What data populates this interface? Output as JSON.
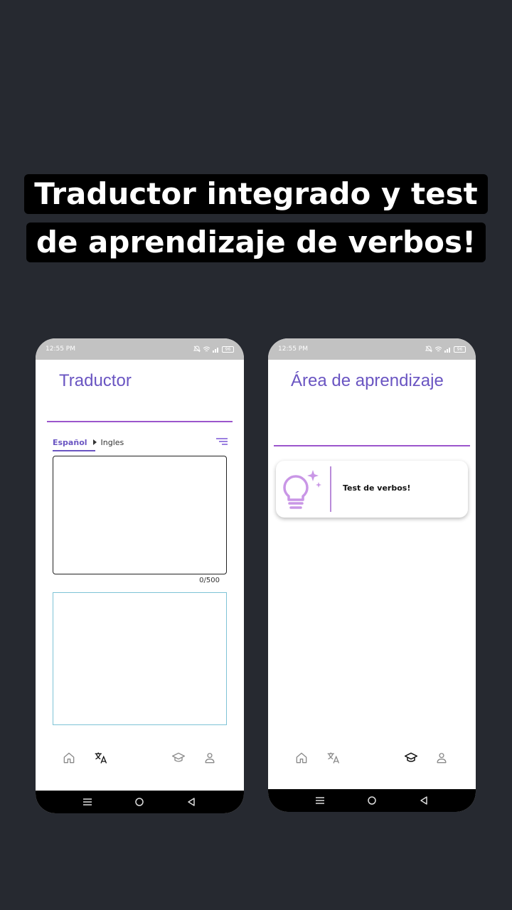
{
  "headline": {
    "line1": "Traductor integrado y test",
    "line2": "de aprendizaje de verbos!"
  },
  "colors": {
    "background": "#262930",
    "accent": "#6a55c2",
    "rule": "#9b55cc",
    "output_border": "#7ec3d6"
  },
  "left_phone": {
    "status": {
      "time": "12:55 PM",
      "battery": "96"
    },
    "title": "Traductor",
    "lang_from": "Español",
    "lang_to": "Ingles",
    "counter": "0/500",
    "nav": [
      "home-icon",
      "translate-icon",
      "school-icon",
      "person-icon"
    ],
    "active_nav": "translate"
  },
  "right_phone": {
    "status": {
      "time": "12:55 PM",
      "battery": "96"
    },
    "title": "Área de aprendizaje",
    "card_label": "Test de verbos!",
    "nav": [
      "home-icon",
      "translate-icon",
      "school-icon",
      "person-icon"
    ],
    "active_nav": "school"
  }
}
